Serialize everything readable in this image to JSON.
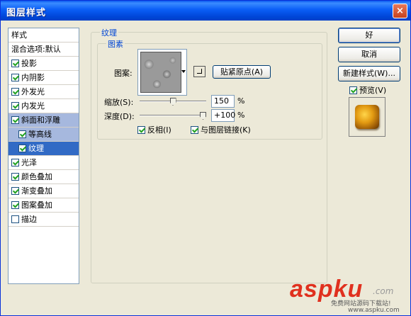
{
  "window": {
    "title": "图层样式",
    "close_glyph": "×"
  },
  "style_list": {
    "header": "样式",
    "blend": "混合选项:默认",
    "items": [
      {
        "label": "投影",
        "checked": true
      },
      {
        "label": "内阴影",
        "checked": true
      },
      {
        "label": "外发光",
        "checked": true
      },
      {
        "label": "内发光",
        "checked": true
      },
      {
        "label": "斜面和浮雕",
        "checked": true
      },
      {
        "label": "等高线",
        "checked": true
      },
      {
        "label": "纹理",
        "checked": true
      },
      {
        "label": "光泽",
        "checked": true
      },
      {
        "label": "颜色叠加",
        "checked": true
      },
      {
        "label": "渐变叠加",
        "checked": true
      },
      {
        "label": "图案叠加",
        "checked": true
      },
      {
        "label": "描边",
        "checked": false
      }
    ]
  },
  "texture": {
    "group_title": "纹理",
    "subgroup_title": "图素",
    "pattern_label": "图案:",
    "snap_button": "贴紧原点(A)",
    "scale_label": "缩放(S):",
    "scale_value": "150",
    "depth_label": "深度(D):",
    "depth_value": "+100",
    "unit": "%",
    "scale_fraction": 0.5,
    "depth_fraction": 1.0,
    "invert": {
      "label": "反相(I)",
      "checked": true
    },
    "link": {
      "label": "与图层链接(K)",
      "checked": true
    }
  },
  "buttons": {
    "ok": "好",
    "cancel": "取消",
    "new_style": "新建样式(W)...",
    "preview": {
      "label": "预览(V)",
      "checked": true
    }
  },
  "watermark": {
    "brand": "aspku",
    "suffix": ".com",
    "line1": "免费网站源码下载站!",
    "line2": "www.aspku.com"
  }
}
